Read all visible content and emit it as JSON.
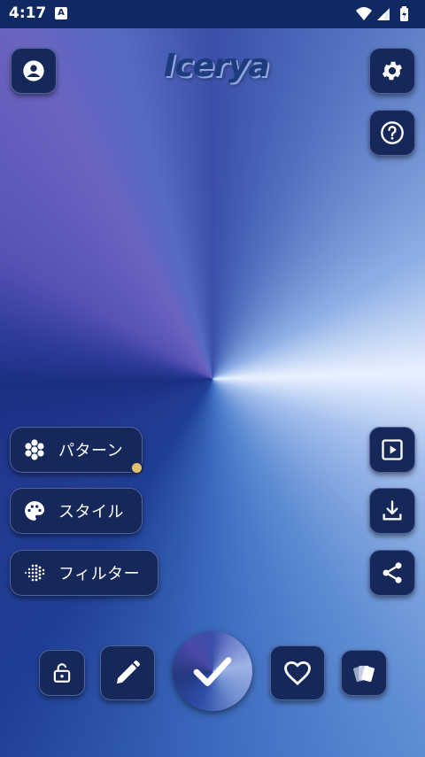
{
  "status_bar": {
    "time": "4:17",
    "notification_badge": "A",
    "icons": [
      "wifi-icon",
      "signal-icon",
      "battery-icon"
    ]
  },
  "app": {
    "logo_text": "Icerya"
  },
  "top_buttons": {
    "left": "account-icon",
    "right": [
      "settings-icon",
      "help-icon"
    ]
  },
  "side_menu": [
    {
      "label": "パターン",
      "icon": "pattern-icon"
    },
    {
      "label": "スタイル",
      "icon": "palette-icon"
    },
    {
      "label": "フィルター",
      "icon": "filter-icon"
    }
  ],
  "right_actions": [
    "play-icon",
    "download-icon",
    "share-icon"
  ],
  "bottom_bar": [
    "lock-icon",
    "pencil-icon",
    "confirm-check-icon",
    "heart-icon",
    "cards-icon"
  ],
  "colors": {
    "button_bg": "#16285a",
    "status_bar": "#0f2a63",
    "accent_dot": "#e2c16e"
  }
}
